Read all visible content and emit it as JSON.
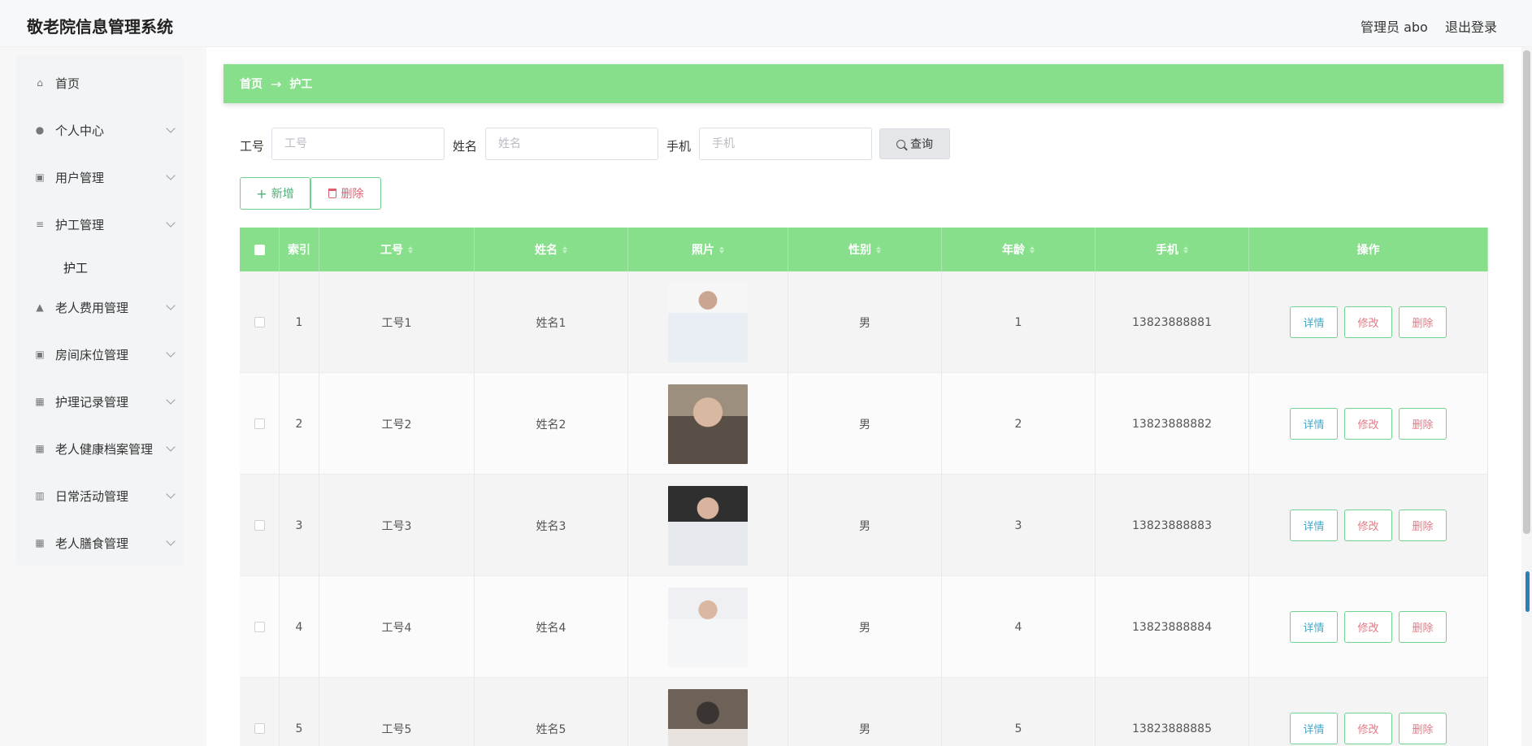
{
  "header": {
    "title": "敬老院信息管理系统",
    "admin": "管理员 abo",
    "logout": "退出登录"
  },
  "sidebar": {
    "items": [
      {
        "label": "首页",
        "icon": "home-icon",
        "glyph": "⌂",
        "expandable": false
      },
      {
        "label": "个人中心",
        "icon": "user-icon",
        "glyph": "●",
        "expandable": true
      },
      {
        "label": "用户管理",
        "icon": "clipboard-icon",
        "glyph": "▣",
        "expandable": true
      },
      {
        "label": "护工管理",
        "icon": "list-icon",
        "glyph": "≡",
        "expandable": true
      },
      {
        "label": "老人费用管理",
        "icon": "thumb-icon",
        "glyph": "▲",
        "expandable": true
      },
      {
        "label": "房间床位管理",
        "icon": "clipboard-icon",
        "glyph": "▣",
        "expandable": true
      },
      {
        "label": "护理记录管理",
        "icon": "grid-icon",
        "glyph": "▦",
        "expandable": true
      },
      {
        "label": "老人健康档案管理",
        "icon": "grid-icon",
        "glyph": "▦",
        "expandable": true
      },
      {
        "label": "日常活动管理",
        "icon": "bar-chart-icon",
        "glyph": "▥",
        "expandable": true
      },
      {
        "label": "老人膳食管理",
        "icon": "grid-icon",
        "glyph": "▦",
        "expandable": true
      }
    ],
    "submenu": {
      "label": "护工"
    }
  },
  "breadcrumb": {
    "home": "首页",
    "arrow": "→",
    "current": "护工"
  },
  "search": {
    "fields": [
      {
        "label": "工号",
        "placeholder": "工号",
        "value": ""
      },
      {
        "label": "姓名",
        "placeholder": "姓名",
        "value": ""
      },
      {
        "label": "手机",
        "placeholder": "手机",
        "value": ""
      }
    ],
    "button": "查询"
  },
  "actions": {
    "add": "新增",
    "delete": "删除"
  },
  "table": {
    "columns": [
      "索引",
      "工号",
      "姓名",
      "照片",
      "性别",
      "年龄",
      "手机",
      "操作"
    ],
    "rows": [
      {
        "index": "1",
        "id": "工号1",
        "name": "姓名1",
        "gender": "男",
        "age": "1",
        "phone": "13823888881"
      },
      {
        "index": "2",
        "id": "工号2",
        "name": "姓名2",
        "gender": "男",
        "age": "2",
        "phone": "13823888882"
      },
      {
        "index": "3",
        "id": "工号3",
        "name": "姓名3",
        "gender": "男",
        "age": "3",
        "phone": "13823888883"
      },
      {
        "index": "4",
        "id": "工号4",
        "name": "姓名4",
        "gender": "男",
        "age": "4",
        "phone": "13823888884"
      },
      {
        "index": "5",
        "id": "工号5",
        "name": "姓名5",
        "gender": "男",
        "age": "5",
        "phone": "13823888885"
      }
    ],
    "row_actions": {
      "detail": "详情",
      "edit": "修改",
      "delete": "删除"
    }
  },
  "colors": {
    "accent": "#87df8c",
    "header_bg": "#f7f8fa",
    "detail": "#49a8c8",
    "danger": "#e27a86"
  }
}
